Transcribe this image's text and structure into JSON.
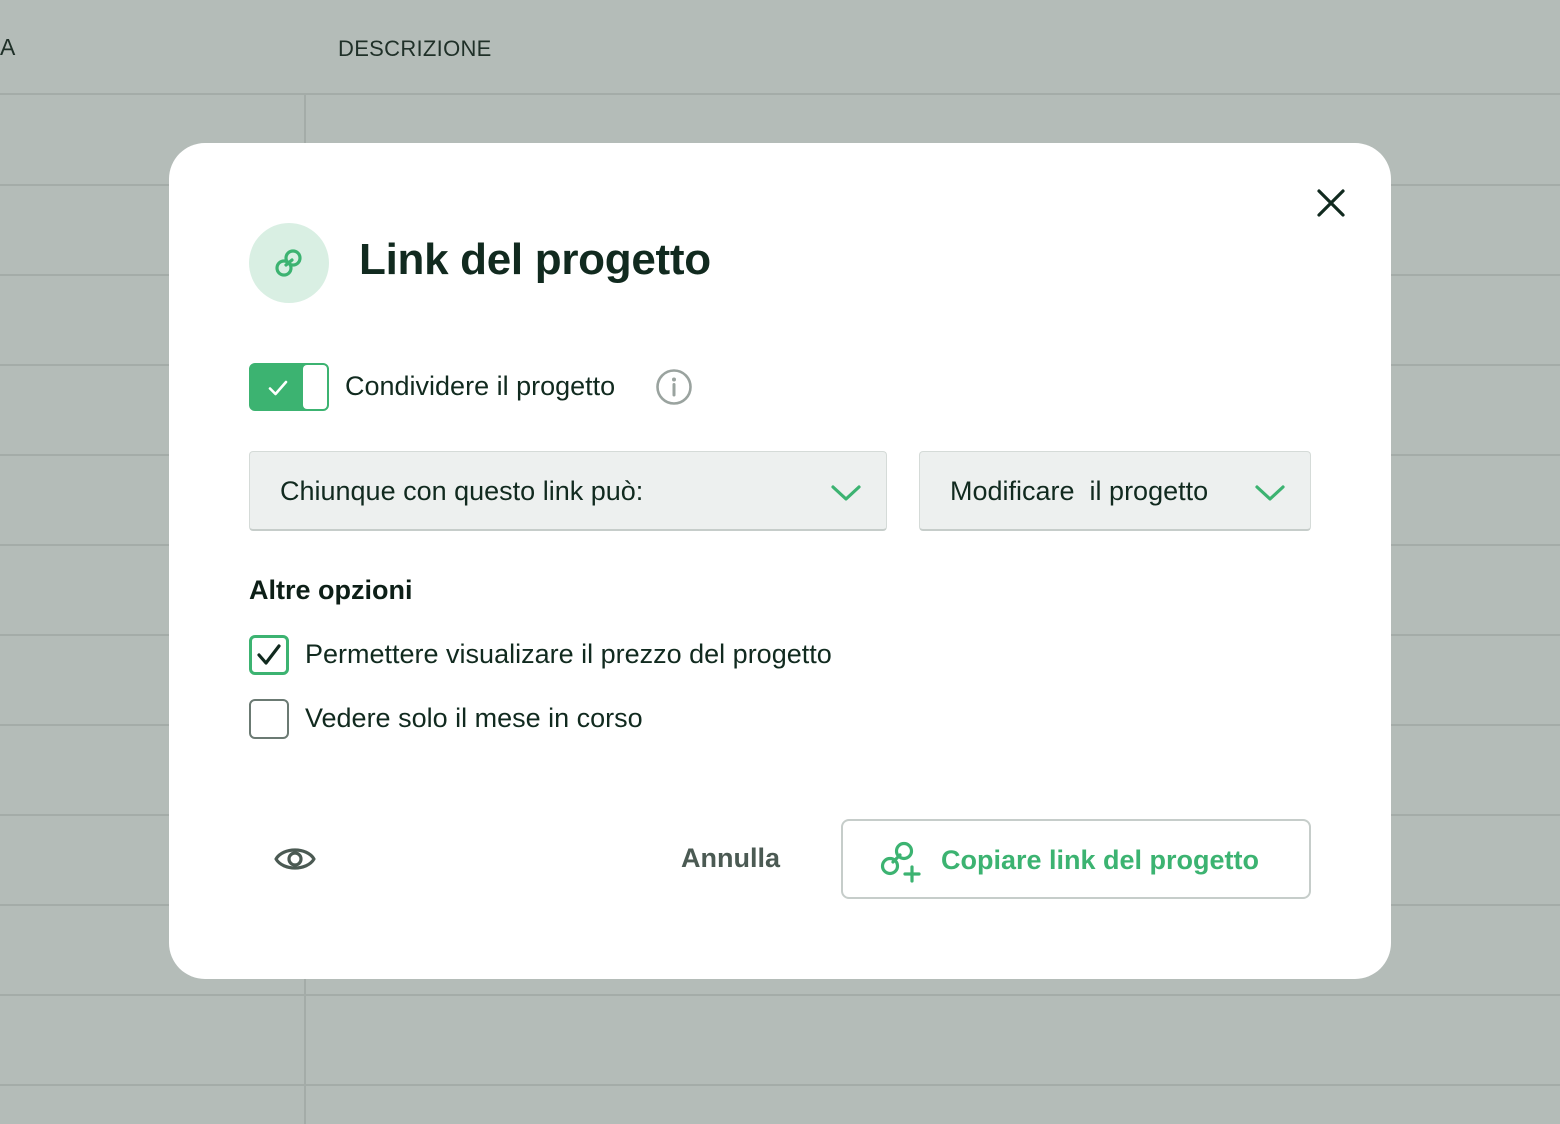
{
  "background": {
    "columns": [
      "A",
      "DESCRIZIONE"
    ]
  },
  "modal": {
    "title": "Link del progetto",
    "title_icon": "link-icon",
    "close_icon": "close-icon",
    "share_toggle": {
      "label": "Condividere il progetto",
      "on": true,
      "info_icon": "info-icon"
    },
    "dropdowns": {
      "audience": {
        "value": "Chiunque con questo link può:",
        "icon": "chevron-down-icon"
      },
      "permission": {
        "value": "Modificare  il progetto",
        "icon": "chevron-down-icon"
      }
    },
    "other_options": {
      "title": "Altre opzioni",
      "items": [
        {
          "label": "Permettere visualizare il prezzo del progetto",
          "checked": true
        },
        {
          "label": "Vedere solo il mese in corso",
          "checked": false
        }
      ]
    },
    "footer": {
      "preview_icon": "eye-icon",
      "cancel_label": "Annulla",
      "copy_label": "Copiare link del progetto",
      "copy_icon": "link-add-icon"
    }
  },
  "colors": {
    "accent": "#3cb371",
    "accent_light": "#d9efe3",
    "text_dark": "#112a1f",
    "overlay": "#b4bcb8"
  }
}
